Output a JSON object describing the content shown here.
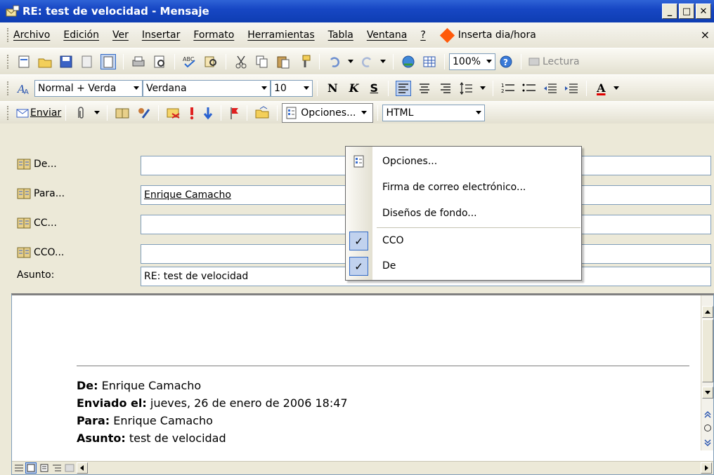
{
  "window": {
    "title": "RE: test de velocidad - Mensaje",
    "buttons": [
      "_",
      "□",
      "✕"
    ]
  },
  "menubar": {
    "items": [
      "Archivo",
      "Edición",
      "Ver",
      "Insertar",
      "Formato",
      "Herramientas",
      "Tabla",
      "Ventana",
      "?"
    ],
    "macro": "Inserta dia/hora",
    "close": "×"
  },
  "toolbar_standard": {
    "zoom": "100%",
    "reading": "Lectura"
  },
  "toolbar_format": {
    "style": "Normal + Verda",
    "font": "Verdana",
    "size": "10",
    "bold": "N",
    "italic": "K",
    "strike": "S",
    "font_color": "A"
  },
  "toolbar_email": {
    "send": "Enviar",
    "options": "Opciones...",
    "format": "HTML"
  },
  "header": {
    "from_label": "De...",
    "to_label": "Para...",
    "to_value": "Enrique Camacho",
    "cc_label": "CC...",
    "bcc_label": "CCO...",
    "subject_label": "Asunto:",
    "subject_value": "RE: test de velocidad"
  },
  "options_menu": {
    "items": [
      {
        "label": "Opciones...",
        "checked": false
      },
      {
        "label": "Firma de correo electrónico...",
        "checked": false
      },
      {
        "label": "Diseños de fondo...",
        "checked": false
      },
      {
        "label": "CCO",
        "checked": true
      },
      {
        "label": "De",
        "checked": true
      }
    ]
  },
  "message": {
    "from_label": "De:",
    "from_value": "Enrique Camacho",
    "sent_label": "Enviado el:",
    "sent_value": "jueves, 26 de enero de 2006 18:47",
    "to_label": "Para:",
    "to_value": "Enrique Camacho",
    "subject_label": "Asunto:",
    "subject_value": "test de velocidad"
  }
}
